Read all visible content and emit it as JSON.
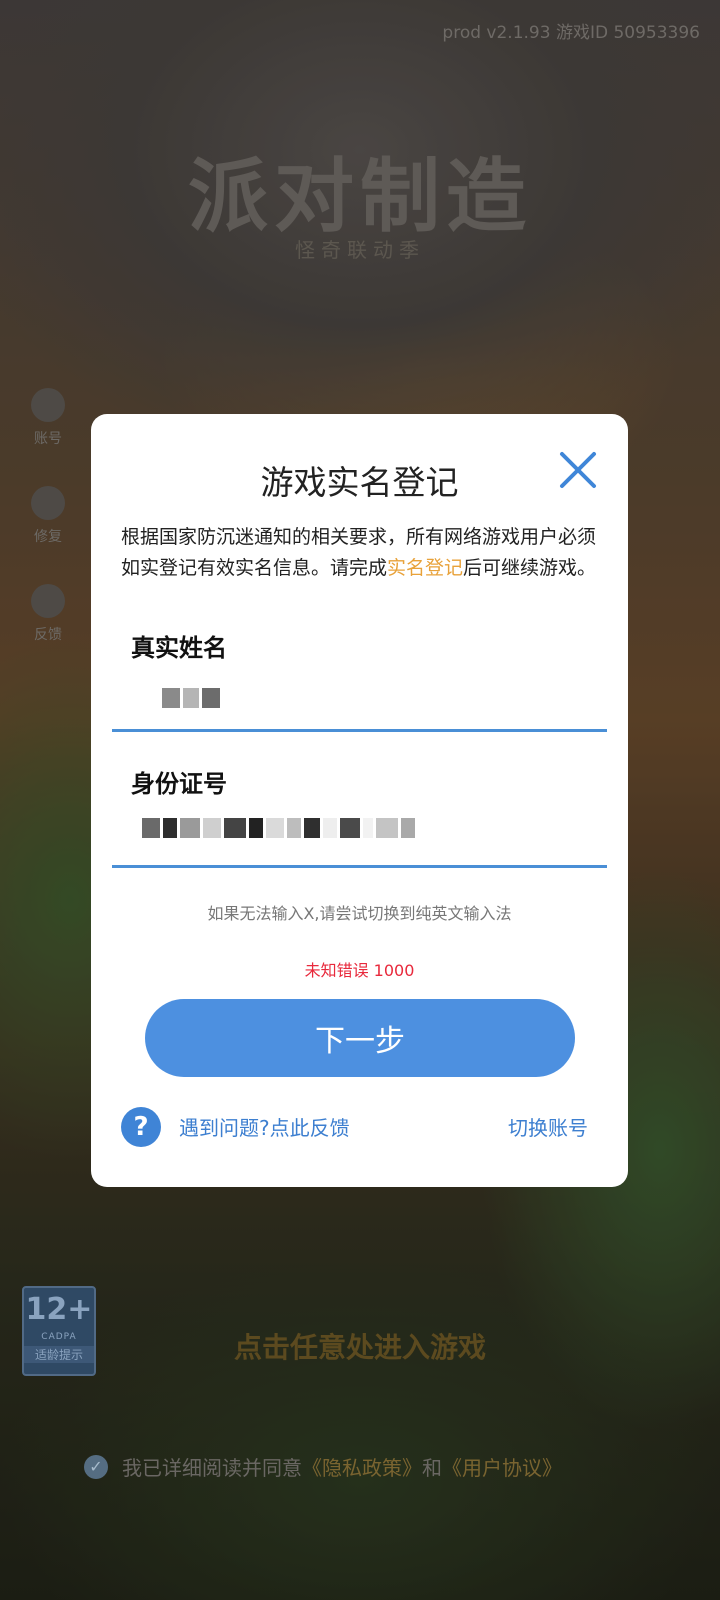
{
  "background": {
    "version": "prod v2.1.93 游戏ID 50953396",
    "game_title": "派对制造",
    "game_subtitle": "怪奇联动季",
    "sidebar": [
      {
        "label": "账号",
        "icon": "user-icon"
      },
      {
        "label": "修复",
        "icon": "tools-icon"
      },
      {
        "label": "反馈",
        "icon": "headset-icon"
      }
    ],
    "rating": {
      "age": "12+",
      "org": "CADPA",
      "tip": "适龄提示"
    },
    "enter_game": "点击任意处进入游戏",
    "agreement": {
      "prefix": "我已详细阅读并同意",
      "privacy": "《隐私政策》",
      "and": "和",
      "terms": "《用户协议》",
      "checked": true
    }
  },
  "dialog": {
    "title": "游戏实名登记",
    "notice_part1": "根据国家防沉迷通知的相关要求，所有网络游戏用户必须如实登记有效实名信息。请完成",
    "notice_highlight": "实名登记",
    "notice_part2": "后可继续游戏。",
    "name_label": "真实姓名",
    "id_label": "身份证号",
    "input_hint": "如果无法输入X,请尝试切换到纯英文输入法",
    "error_text": "未知错误 1000",
    "next_button": "下一步",
    "help_icon_text": "?",
    "help_link": "遇到问题?点此反馈",
    "switch_account": "切换账号"
  },
  "colors": {
    "accent": "#4d90e0",
    "highlight": "#e8a23a",
    "error": "#e8293c",
    "link": "#3d7fd0"
  }
}
